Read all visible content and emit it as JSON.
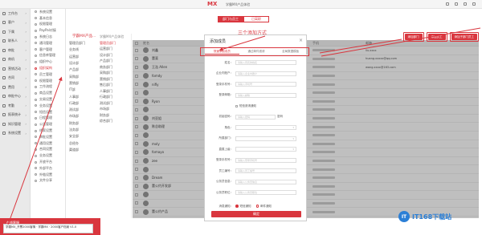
{
  "topbar": {
    "brand": "",
    "app": "MX",
    "app2": "学霸MX产品体验"
  },
  "side1": [
    "工作台",
    "客户",
    "下属",
    "联系人",
    "审批",
    "商机",
    "营销活动",
    "合同",
    "费用",
    "审批中心",
    "考勤",
    "报表统计",
    "知识管理",
    "系统设置"
  ],
  "side2": [
    "系统设置",
    "基本信息",
    "权限管理",
    "PayPal对接",
    "系统日志",
    "通讯管理",
    "客户管理",
    "信息库管理",
    "组织中心",
    "组织架构",
    "员工管理",
    "权限管理",
    "工作流程",
    "商品设置",
    "交易设置",
    "业务设置",
    "短信设置",
    "日程管理",
    "公告管理",
    "线索设置",
    "审批设置",
    "通用设置",
    "合同设置",
    "业务设置",
    "开放平台",
    "外部平台",
    "外链设置",
    "文件分享"
  ],
  "bottom": {
    "label": "在线客服",
    "popup": "学霸MX_开票2000客情 · 学霸MX · 2000客户档案 V1.0"
  },
  "tree": {
    "root": "学霸MX产品...",
    "items": [
      "管理员部门",
      "业务线",
      "运营部",
      "设计部",
      "产品部",
      "采购部",
      "营销部",
      "IT部",
      "人事部",
      "行政部",
      "测试部",
      "市场部",
      "财务部",
      "法务部",
      "安全部",
      "总经办",
      "渠道部"
    ],
    "active_index": 9
  },
  "dept_col": {
    "header": "学霸MX产品体验",
    "items": [
      "管理员部门",
      "运营部门",
      "设计部门",
      "产品部门",
      "商务部门",
      "采购部门",
      "营销部门",
      "售后部门",
      "人事部门",
      "行政部门",
      "测试部门",
      "市场部",
      "财务部",
      "综合部门"
    ],
    "active_index": 0
  },
  "tabs": {
    "active": "部门与员工",
    "inactive": "已离职"
  },
  "actions": [
    "添加部门",
    "添加员工",
    "添加子部门员工"
  ],
  "annot": "三个添加方式",
  "table": {
    "headers": {
      "name": "姓名",
      "phone": "手机",
      "email": "邮箱"
    },
    "rows": [
      {
        "name": "刘鑫",
        "phone": "",
        "email": "liu.xxxx"
      },
      {
        "name": "董斐",
        "phone": "",
        "email": "huang.xxxxx@qq.com"
      },
      {
        "name": "王浩 Allen",
        "phone": "",
        "email": "wang.xxxx@163.com"
      },
      {
        "name": "fomdy",
        "phone": "",
        "email": ""
      },
      {
        "name": "nifly",
        "phone": "",
        "email": ""
      },
      {
        "name": "",
        "phone": "",
        "email": ""
      },
      {
        "name": "Ryon",
        "phone": "",
        "email": ""
      },
      {
        "name": "",
        "phone": "",
        "email": ""
      },
      {
        "name": "刘亚姐",
        "phone": "",
        "email": ""
      },
      {
        "name": "陈总助理",
        "phone": "",
        "email": ""
      },
      {
        "name": "",
        "phone": "",
        "email": ""
      },
      {
        "name": "mxly",
        "phone": "",
        "email": ""
      },
      {
        "name": "fomayo",
        "phone": "",
        "email": ""
      },
      {
        "name": "zee",
        "phone": "",
        "email": ""
      },
      {
        "name": "",
        "phone": "",
        "email": ""
      },
      {
        "name": "Dream",
        "phone": "",
        "email": ""
      },
      {
        "name": "董公约开发部",
        "phone": "",
        "email": ""
      },
      {
        "name": "",
        "phone": "",
        "email": ""
      },
      {
        "name": "",
        "phone": "",
        "email": ""
      },
      {
        "name": "董公约产品",
        "phone": "",
        "email": ""
      }
    ]
  },
  "modal": {
    "title": "添加成员",
    "tabs": [
      "快速添加成员",
      "通过邮件邀请",
      "全局数据模板"
    ],
    "fields": [
      {
        "label": "姓名：",
        "ph": "请输入真实的姓名"
      },
      {
        "label": "企业内账户：",
        "ph": "请输入企业内账户"
      },
      {
        "label": "登录手机号：",
        "ph": "请输入手机号"
      },
      {
        "label": "登录邮箱：",
        "ph": "请输入邮箱"
      },
      {
        "label": "",
        "ph": "",
        "check": "短信邀请通知"
      },
      {
        "label": "初始密码：",
        "ph": "请输入密码",
        "extra": "密码"
      },
      {
        "label": "角色：",
        "ph": "",
        "select": true
      },
      {
        "label": "所属部门：",
        "ph": "",
        "select": true
      },
      {
        "label": "直属上级：",
        "ph": "",
        "select": true
      },
      {
        "label": "登录手机号：",
        "ph": "请输入登录手机号"
      },
      {
        "label": "员工编号：",
        "ph": "请输入员工编号"
      },
      {
        "label": "公务员信息：",
        "ph": "请输入公务员信息"
      },
      {
        "label": "公务员职位：",
        "ph": "请输入公务员职位"
      }
    ],
    "notify_label": "消息通知：",
    "notify_opts": [
      "短信通知",
      "邮件通知"
    ],
    "confirm": "确定"
  },
  "watermark": {
    "logo": "IT",
    "text": "IT168下载站"
  }
}
